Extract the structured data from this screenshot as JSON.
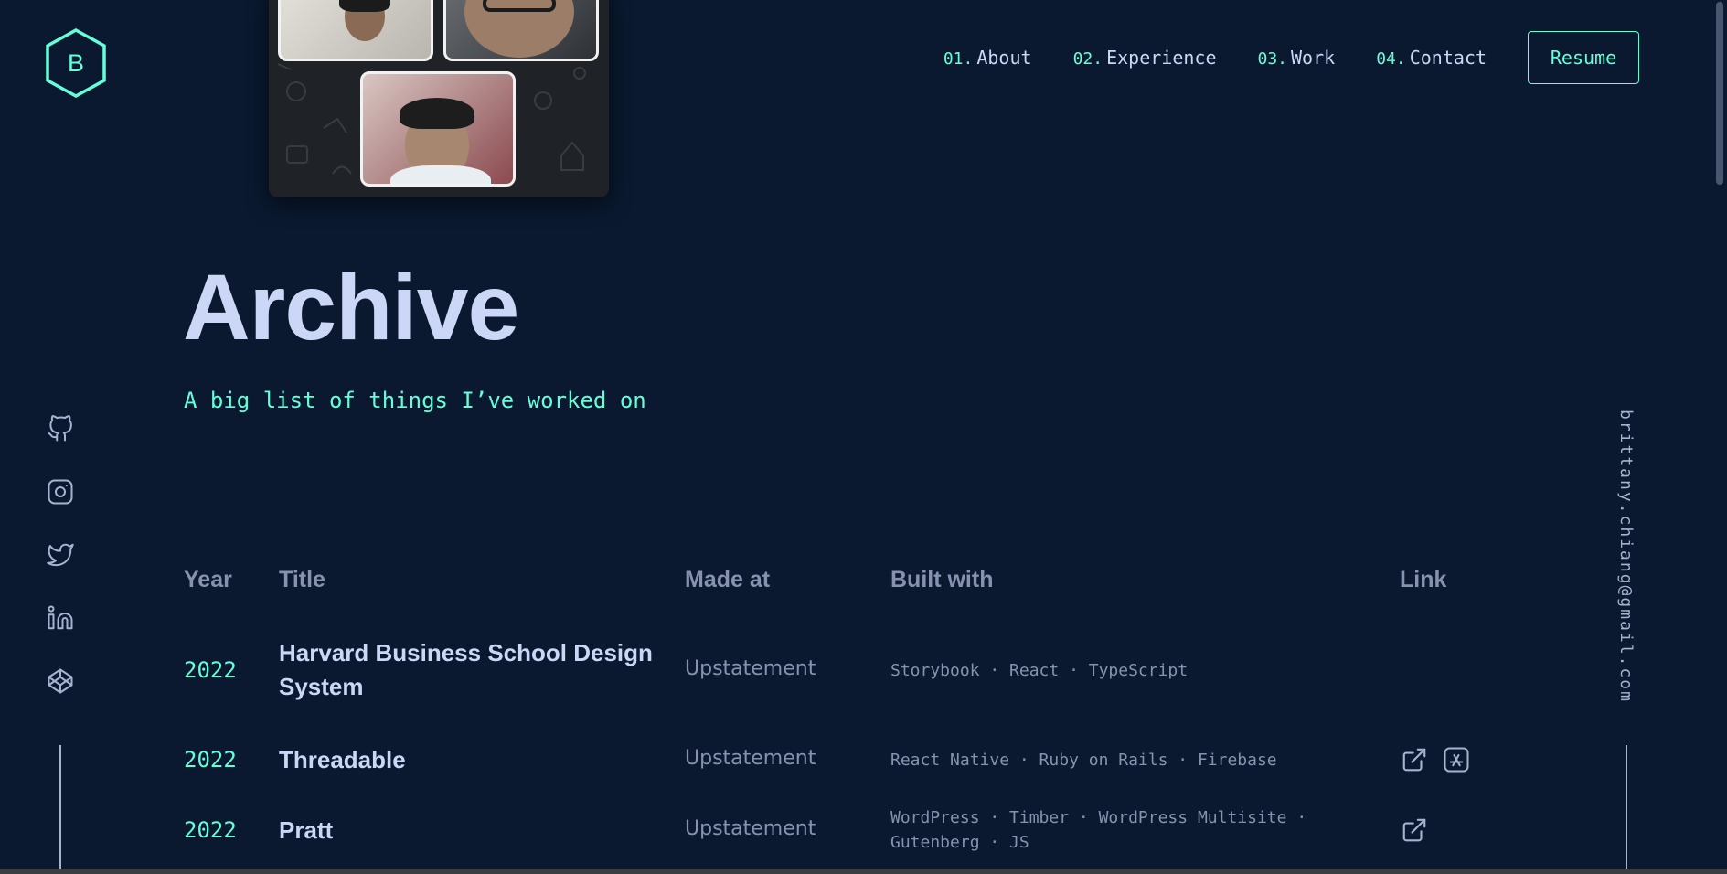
{
  "logo": {
    "letter": "B"
  },
  "nav": {
    "items": [
      {
        "num": "01.",
        "label": "About"
      },
      {
        "num": "02.",
        "label": "Experience"
      },
      {
        "num": "03.",
        "label": "Work"
      },
      {
        "num": "04.",
        "label": "Contact"
      }
    ],
    "resume_label": "Resume"
  },
  "page": {
    "title": "Archive",
    "subtitle": "A big list of things I’ve worked on"
  },
  "social": [
    "github-icon",
    "instagram-icon",
    "twitter-icon",
    "linkedin-icon",
    "codepen-icon"
  ],
  "email": "brittany.chiang@gmail.com",
  "table": {
    "headers": {
      "year": "Year",
      "title": "Title",
      "made": "Made at",
      "built": "Built with",
      "link": "Link"
    },
    "rows": [
      {
        "year": "2022",
        "title": "Harvard Business School Design System",
        "made": "Upstatement",
        "built": "Storybook · React · TypeScript",
        "links": []
      },
      {
        "year": "2022",
        "title": "Threadable",
        "made": "Upstatement",
        "built": "React Native · Ruby on Rails · Firebase",
        "links": [
          "external-link-icon",
          "app-store-icon"
        ]
      },
      {
        "year": "2022",
        "title": "Pratt",
        "made": "Upstatement",
        "built": "WordPress · Timber · WordPress Multisite · Gutenberg · JS",
        "links": [
          "external-link-icon"
        ]
      }
    ]
  },
  "colors": {
    "background": "#0a192f",
    "accent": "#64ffda",
    "text": "#ccd6f6",
    "muted": "#8892b0"
  }
}
